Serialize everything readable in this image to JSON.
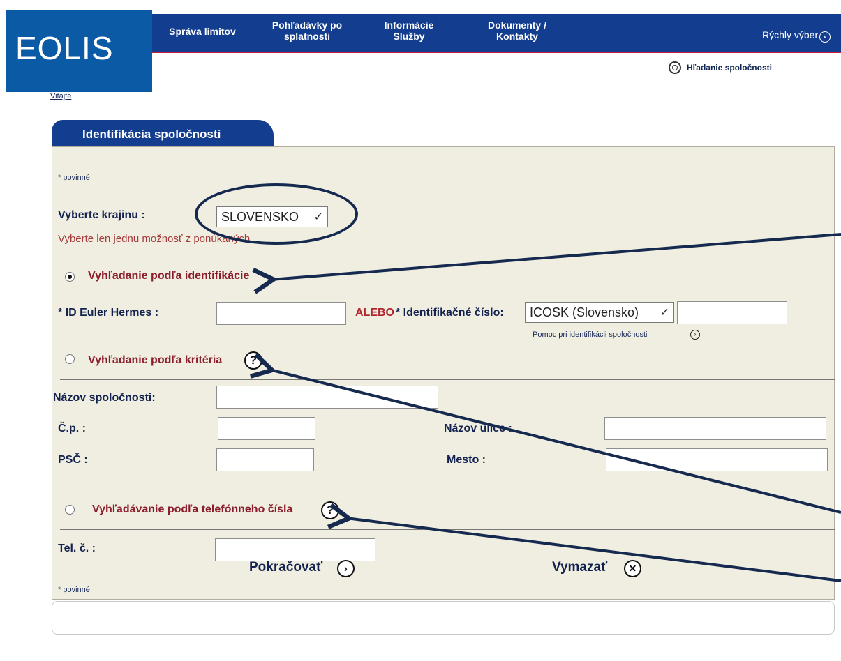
{
  "logo": {
    "text": "EOLIS"
  },
  "nav": {
    "items": [
      {
        "label": "Správa limitov"
      },
      {
        "label": "Pohľadávky po splatnosti"
      },
      {
        "label": "Informácie Služby"
      },
      {
        "label": "Dokumenty / Kontakty"
      }
    ],
    "quick_select": "Rýchly výber"
  },
  "company_search_link": "Hľadanie spoločnosti",
  "welcome": "Vitajte",
  "panel": {
    "tab_title": "Identifikácia spoločnosti",
    "required_note_top": "* povinné",
    "country_label": "Vyberte krajinu :",
    "country_value": "SLOVENSKO",
    "choose_one_note": "Vyberte len jednu možnosť z ponúkaných.",
    "section_identification": "Vyhľadanie podľa identifikácie",
    "id_euler_label": "* ID Euler Hermes :",
    "id_euler_value": "",
    "or_label": "ALEBO",
    "id_number_label": "* Identifikačné číslo:",
    "id_number_type": "ICOSK (Slovensko)",
    "id_number_value": "",
    "help_identification": "Pomoc pri identifikácii spoločnosti",
    "section_criteria": "Vyhľadanie podľa kritéria",
    "company_name_label": "Názov spoločnosti:",
    "company_name_value": "",
    "house_no_label": "Č.p. :",
    "house_no_value": "",
    "street_label": "Názov ulice :",
    "street_value": "",
    "zip_label": "PSČ :",
    "zip_value": "",
    "city_label": "Mesto :",
    "city_value": "",
    "section_phone": "Vyhľadávanie podľa telefónneho čísla",
    "phone_label": "Tel. č. :",
    "phone_value": "",
    "required_note_bottom": "* povinné",
    "continue_label": "Pokračovať",
    "clear_label": "Vymazať"
  },
  "icons": {
    "help": "question-circle-icon",
    "continue": "chevron-right-circle-icon",
    "clear": "close-circle-icon",
    "search": "magnifier-icon",
    "quick_select": "chevron-down-circle-icon"
  },
  "colors": {
    "nav_bg": "#133e8f",
    "nav_accent": "#c81d3c",
    "logo_bg": "#0a5aa6",
    "panel_bg": "#efeee1",
    "section_title": "#8b1d2c",
    "annotation": "#16294f"
  }
}
